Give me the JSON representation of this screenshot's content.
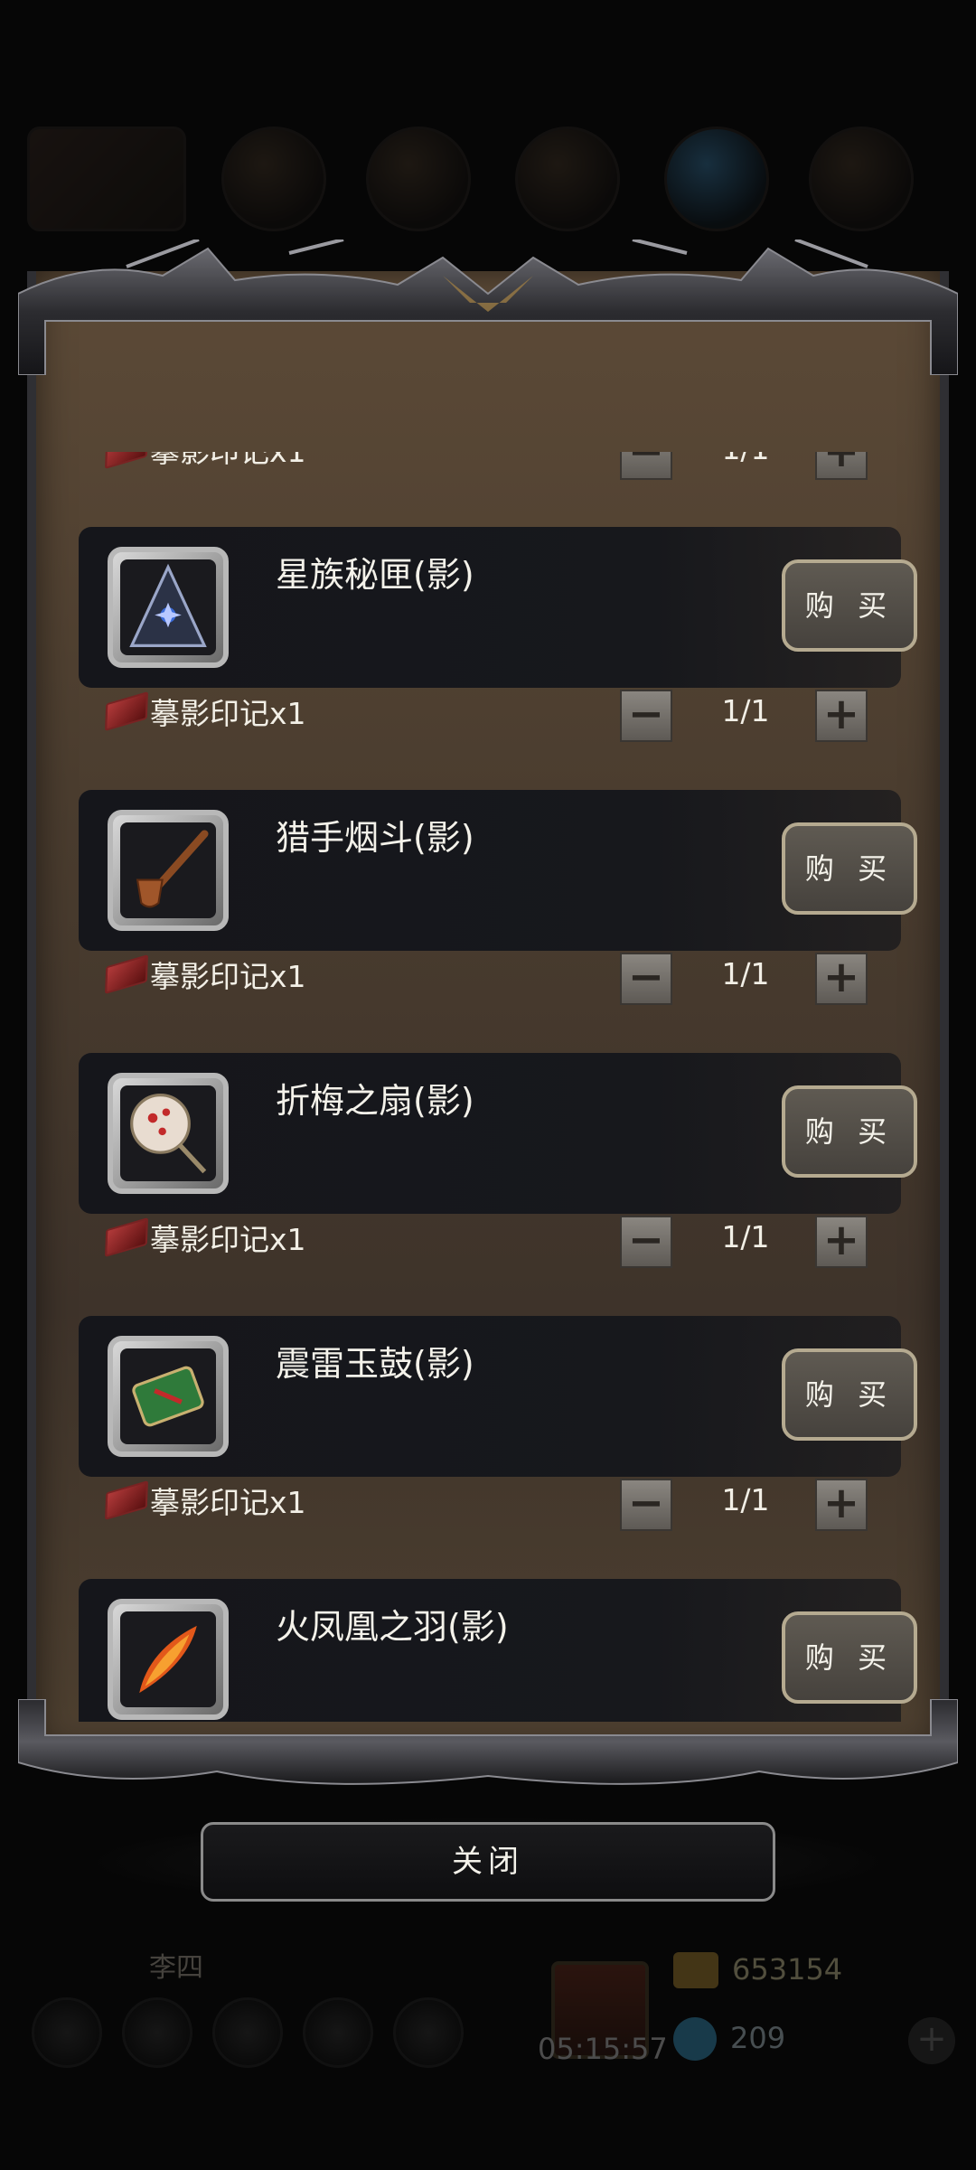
{
  "shop": {
    "items": [
      {
        "name": "星族秘匣(影)",
        "icon": "star-clan-box-icon",
        "cost": "摹影印记x1",
        "qty": "1/1"
      },
      {
        "name": "猎手烟斗(影)",
        "icon": "hunter-pipe-icon",
        "cost": "摹影印记x1",
        "qty": "1/1"
      },
      {
        "name": "折梅之扇(影)",
        "icon": "plum-fan-icon",
        "cost": "摹影印记x1",
        "qty": "1/1"
      },
      {
        "name": "震雷玉鼓(影)",
        "icon": "thunder-drum-icon",
        "cost": "摹影印记x1",
        "qty": "1/1"
      },
      {
        "name": "火凤凰之羽(影)",
        "icon": "phoenix-feather-icon"
      }
    ],
    "top_partial_cost": "摹影印记x1",
    "top_partial_qty": "1/1",
    "buy_label": "购 买",
    "minus": "−",
    "plus": "+",
    "close_label": "关闭"
  },
  "background": {
    "player_name": "李四",
    "timer": "05:15:57",
    "gold": "653154",
    "gems": "209"
  }
}
